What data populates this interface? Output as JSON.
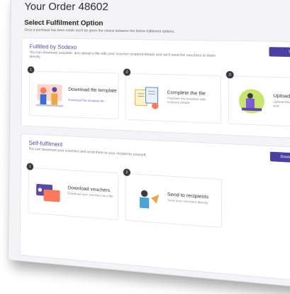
{
  "order": {
    "title": "Your Order 48602"
  },
  "fulfilment": {
    "title": "Select Fulfilment Option",
    "subtitle": "Once a purchase has been made you'll be given the choice between the below fulfilment options."
  },
  "by_sodexo": {
    "heading": "Fulfilled by Sodexo",
    "description": "You can download, populate, and upload a file with your voucher recipient details and we'll send the vouchers to them directly.",
    "button_label": "Start Process",
    "steps": [
      {
        "number": "1",
        "title": "Download file template",
        "link": "Download the template file"
      },
      {
        "number": "2",
        "title": "Complete the file",
        "note": "Populate the template with recipient details"
      },
      {
        "number": "3",
        "title": "Upload and relax",
        "note": "Upload the file and we'll do the rest"
      }
    ]
  },
  "self_fulfilment": {
    "heading": "Self-fulfilment",
    "description": "You can download your vouchers and send them to your recipients yourself.",
    "button_label": "Download your Vouchers",
    "steps": [
      {
        "number": "1",
        "title": "Download vouchers",
        "note": "Download your vouchers as a file"
      },
      {
        "number": "2",
        "title": "Send to recipients",
        "note": "Send your vouchers directly"
      }
    ]
  }
}
